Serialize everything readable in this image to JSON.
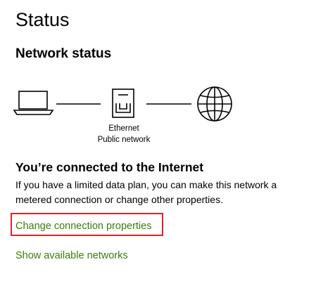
{
  "header": {
    "title": "Status"
  },
  "network_status": {
    "heading": "Network status",
    "adapter": {
      "name": "Ethernet",
      "profile": "Public network"
    },
    "icons": [
      "laptop-icon",
      "ethernet-port-icon",
      "globe-icon"
    ]
  },
  "connection": {
    "title": "You’re connected to the Internet",
    "description": "If you have a limited data plan, you can make this network a metered connection or change other properties."
  },
  "links": {
    "change_properties": "Change connection properties",
    "show_networks": "Show available networks"
  },
  "colors": {
    "link": "#3a7d0c",
    "highlight": "#d9252b"
  }
}
